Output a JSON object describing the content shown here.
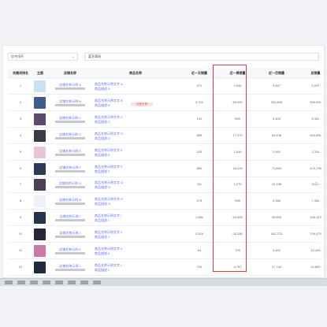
{
  "filters": {
    "sort_label": "综合排序",
    "search_value": "蓝牙耳机"
  },
  "columns": [
    "关键词排名",
    "主图",
    "店铺名称",
    "商品名称",
    "近一天销量",
    "近一周销量",
    "近一月销量",
    "总销量"
  ],
  "rows": [
    {
      "rank": "1",
      "store": "店铺名称示例 A",
      "name_line1": "商品名称示例文字 A",
      "name_line2": "商品描述 A",
      "tag": "",
      "day": "370",
      "week": "2,008",
      "month": "3,847",
      "total": "5,037",
      "thumb": "#c8e3ee"
    },
    {
      "rank": "2",
      "store": "店铺名称示例 B",
      "name_line1": "商品名称示例文字 B",
      "name_line2": "商品描述 B",
      "tag": "标签示例",
      "day": "3,741",
      "week": "48,099",
      "month": "202,528",
      "total": "300,061",
      "thumb": "#3f5d8a"
    },
    {
      "rank": "3",
      "store": "店铺名称示例 C",
      "name_line1": "商品名称示例文字 C",
      "name_line2": "商品描述 C",
      "tag": "",
      "day": "149",
      "week": "959",
      "month": "4,404",
      "total": "5,351",
      "thumb": "#5a4a6e"
    },
    {
      "rank": "4",
      "store": "店铺名称示例 D",
      "name_line1": "商品名称示例文字 D",
      "name_line2": "商品描述 D",
      "tag": "",
      "day": "896",
      "week": "17,973",
      "month": "93,438",
      "total": "644,651",
      "thumb": "#3a3a48"
    },
    {
      "rank": "5",
      "store": "店铺名称示例 E",
      "name_line1": "商品名称示例文字 E",
      "name_line2": "商品描述 E",
      "tag": "",
      "day": "154",
      "week": "1,046",
      "month": "2,061",
      "total": "2,116",
      "thumb": "#e7c5d6"
    },
    {
      "rank": "6",
      "store": "店铺名称示例 F",
      "name_line1": "商品名称示例文字 F",
      "name_line2": "商品描述 F",
      "tag": "",
      "day": "850",
      "week": "15,128",
      "month": "71,654",
      "total": "423,706",
      "thumb": "#2f3a5a"
    },
    {
      "rank": "7",
      "store": "店铺名称示例 G",
      "name_line1": "商品名称示例文字 G",
      "name_line2": "商品描述 G",
      "tag": "",
      "day": "111",
      "week": "1,270",
      "month": "10,198",
      "total": "10万+",
      "thumb": "#4c4058"
    },
    {
      "rank": "8",
      "store": "店铺名称示例 H",
      "name_line1": "商品名称示例文字 H",
      "name_line2": "商品描述 H",
      "tag": "",
      "day": "175",
      "week": "946",
      "month": "3,366",
      "total": "7,454",
      "thumb": "#eef1f5"
    },
    {
      "rank": "9",
      "store": "店铺名称示例 I",
      "name_line1": "商品名称示例文字 I",
      "name_line2": "商品描述 I",
      "tag": "",
      "day": "1,681",
      "week": "46,009",
      "month": "99,609",
      "total": "106,113",
      "thumb": "#25354d"
    },
    {
      "rank": "10",
      "store": "店铺名称示例 J",
      "name_line1": "商品名称示例文字 J",
      "name_line2": "商品描述 J",
      "tag": "",
      "day": "2,614",
      "week": "28,336",
      "month": "163,722",
      "total": "709,470",
      "thumb": "#2a2536"
    },
    {
      "rank": "11",
      "store": "店铺名称示例 K",
      "name_line1": "商品名称示例文字 K",
      "name_line2": "商品描述 K",
      "tag": "",
      "day": "81",
      "week": "725",
      "month": "3,401",
      "total": "12,264",
      "thumb": "#c97aa4"
    },
    {
      "rank": "12",
      "store": "店铺名称示例 L",
      "name_line1": "商品名称示例文字 L",
      "name_line2": "商品描述 L",
      "tag": "",
      "day": "794",
      "week": "4,797",
      "month": "17,744",
      "total": "42,600",
      "thumb": "#202a3c"
    }
  ],
  "colors": {
    "highlight": "#e63b3b",
    "link": "#5b6cff",
    "tag_bg": "#fde2e2",
    "tag_text": "#e14b4b"
  }
}
